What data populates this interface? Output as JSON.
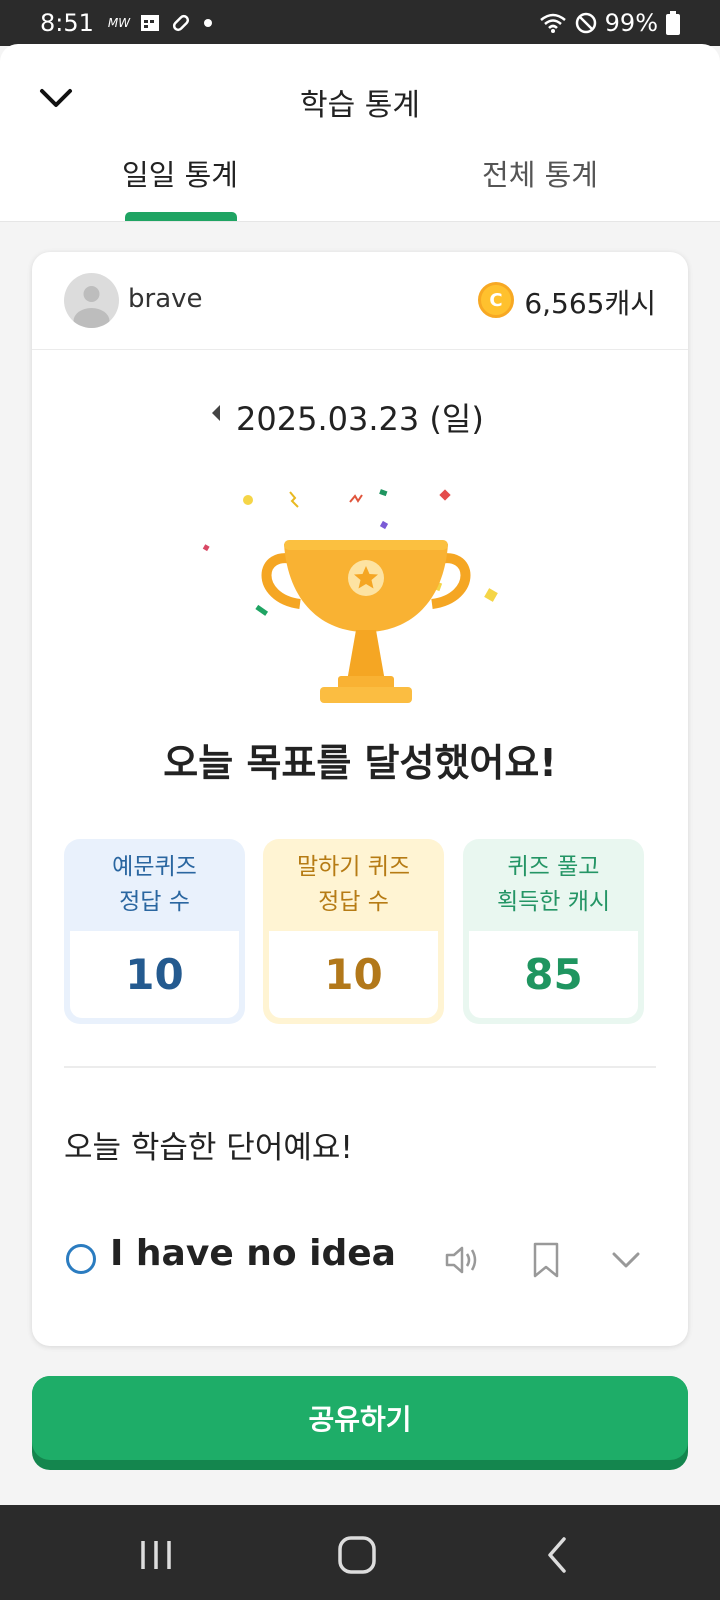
{
  "status_bar": {
    "time": "8:51",
    "notif_text": "MW",
    "battery": "99%"
  },
  "header": {
    "title": "학습 통계",
    "tabs": [
      {
        "label": "일일 통계"
      },
      {
        "label": "전체 통계"
      }
    ]
  },
  "profile": {
    "username": "brave",
    "cash": "6,565캐시"
  },
  "date": "2025.03.23 (일)",
  "goal_text": "오늘 목표를 달성했어요!",
  "stats": [
    {
      "label": "예문퀴즈\n정답 수",
      "value": "10",
      "color": "#245a8f"
    },
    {
      "label": "말하기 퀴즈\n정답 수",
      "value": "10",
      "color": "#b2781a"
    },
    {
      "label": "퀴즈 풀고\n획득한 캐시",
      "value": "85",
      "color": "#1f9560"
    }
  ],
  "words_title": "오늘 학습한 단어예요!",
  "words": [
    {
      "text": "I have no idea"
    }
  ],
  "share_button": "공유하기",
  "colors": {
    "accent": "#1ead68",
    "tab_indicator": "#1fa463",
    "trophy": "#f9b233"
  }
}
